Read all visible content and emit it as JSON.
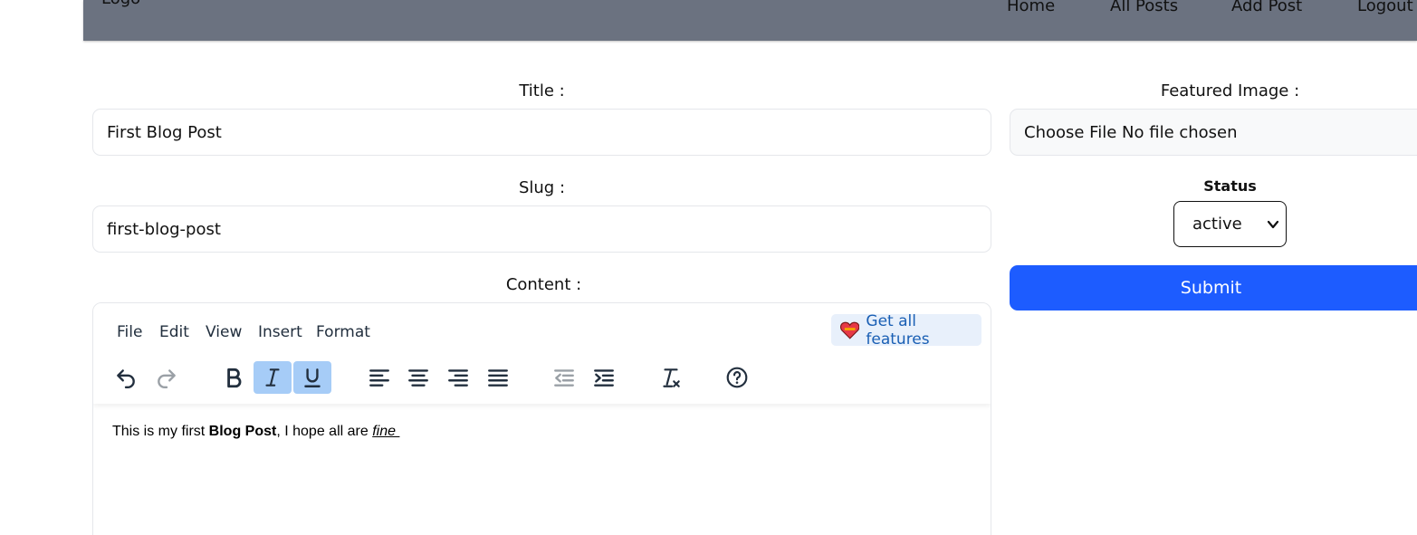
{
  "navbar": {
    "logo": "Logo",
    "items": [
      "Home",
      "All Posts",
      "Add Post",
      "Logout"
    ]
  },
  "form": {
    "title_label": "Title :",
    "title_value": "First Blog Post",
    "slug_label": "Slug :",
    "slug_value": "first-blog-post",
    "content_label": "Content :",
    "featured_label": "Featured Image :",
    "file_button": "Choose File",
    "file_status": "No file chosen",
    "status_label": "Status",
    "status_value": "active",
    "submit_label": "Submit"
  },
  "editor": {
    "menu": [
      "File",
      "Edit",
      "View",
      "Insert",
      "Format"
    ],
    "promo": "Get all features",
    "content": {
      "part1": "This is my first ",
      "bold": "Blog Post",
      "part2": ", I hope all are ",
      "italic_underline": "fine "
    },
    "active_formats": [
      "italic",
      "underline"
    ]
  },
  "colors": {
    "navbar": "#6b7280",
    "submit": "#1d5cff",
    "active_button": "#a6ccf7",
    "promo_text": "#1a5fb4"
  }
}
